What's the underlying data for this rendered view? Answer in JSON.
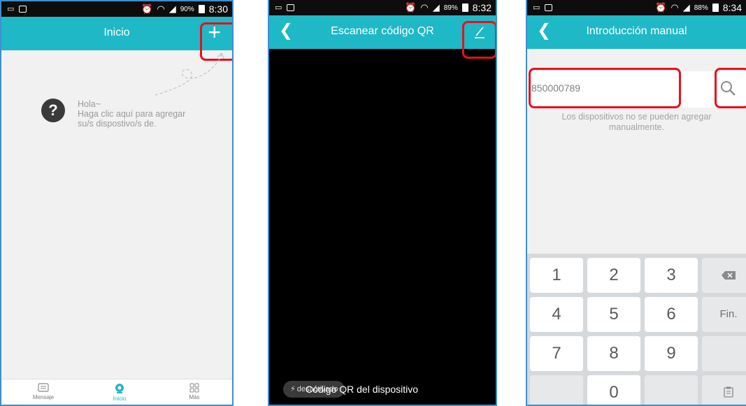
{
  "screen1": {
    "status": {
      "battery": "90%",
      "time": "8:30"
    },
    "title": "Inicio",
    "add_icon": "plus-icon",
    "hint_lines": [
      "Hola~",
      "Haga clic aquí para agregar",
      "su/s dispostivo/s de."
    ],
    "tabs": [
      {
        "label": "Mensaje",
        "icon": "message-icon"
      },
      {
        "label": "Inicio",
        "icon": "camera-icon",
        "active": true
      },
      {
        "label": "Más",
        "icon": "grid-icon"
      }
    ]
  },
  "screen2": {
    "status": {
      "battery": "89%",
      "time": "8:32"
    },
    "title": "Escanear código QR",
    "edit_icon": "pencil-icon",
    "flash_label": "desactivado",
    "caption": "Código QR del dispositivo"
  },
  "screen3": {
    "status": {
      "battery": "88%",
      "time": "8:34"
    },
    "title": "Introducción manual",
    "input_value": "850000789",
    "note_lines": [
      "Los dispositivos no se pueden agregar",
      "manualmente."
    ],
    "keys": [
      "1",
      "2",
      "3",
      "4",
      "5",
      "6",
      "7",
      "8",
      "9",
      "0"
    ],
    "end_key": "Fin."
  },
  "colors": {
    "accent": "#1fb8c6",
    "highlight": "#e8101c",
    "frame": "#3e8fd0"
  }
}
